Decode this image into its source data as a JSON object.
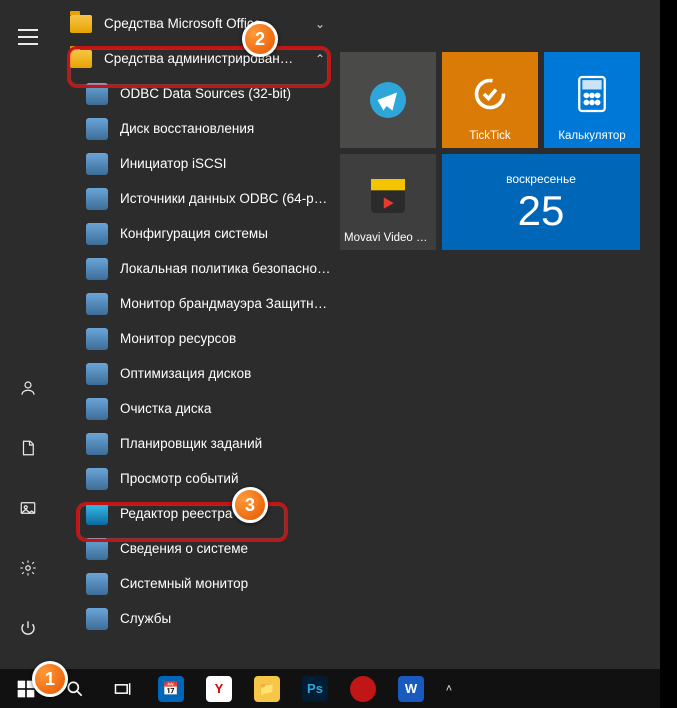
{
  "groups": {
    "office": "Средства Microsoft Office",
    "admin": "Средства администрирования..."
  },
  "apps": [
    "ODBC Data Sources (32-bit)",
    "Диск восстановления",
    "Инициатор iSCSI",
    "Источники данных ODBC (64-раз...",
    "Конфигурация системы",
    "Локальная политика безопасности",
    "Монитор брандмауэра Защитник...",
    "Монитор ресурсов",
    "Оптимизация дисков",
    "Очистка диска",
    "Планировщик заданий",
    "Просмотр событий",
    "Редактор реестра",
    "Сведения о системе",
    "Системный монитор",
    "Службы"
  ],
  "tiles": {
    "telegram": "",
    "ticktick": "TickTick",
    "calc": "Калькулятор",
    "movavi": "Movavi Video Converter...",
    "calendar_dow": "воскресенье",
    "calendar_day": "25"
  },
  "badges": {
    "b1": "1",
    "b2": "2",
    "b3": "3"
  }
}
